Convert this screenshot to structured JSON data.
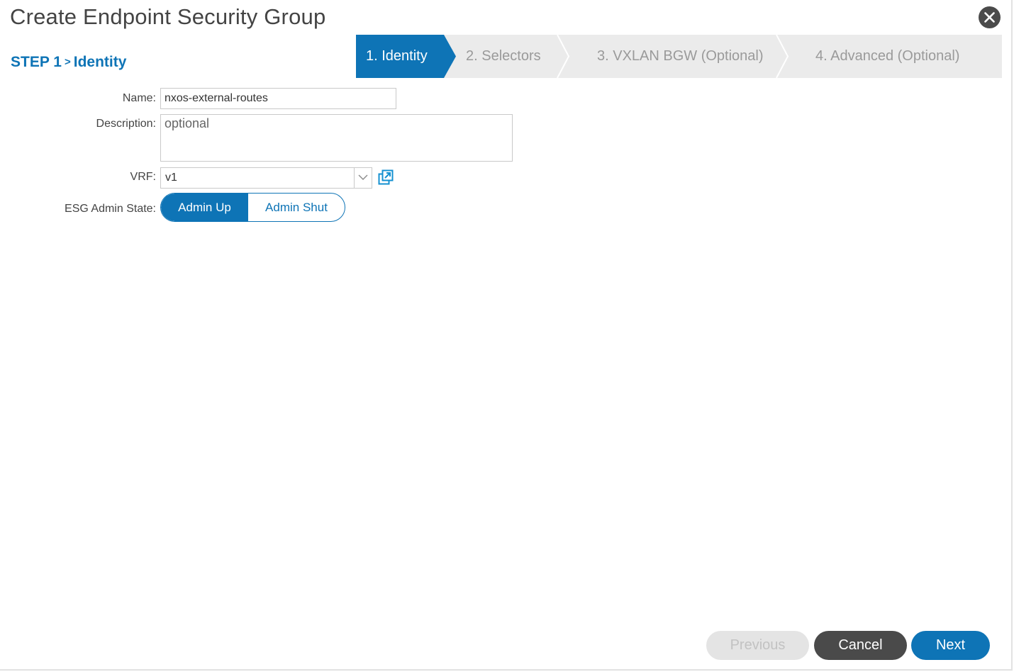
{
  "dialog": {
    "title": "Create Endpoint Security Group",
    "close_icon": "close-icon"
  },
  "step": {
    "prefix": "STEP 1",
    "separator": ">",
    "name": "Identity"
  },
  "wizard": {
    "steps": [
      {
        "label": "1. Identity",
        "active": true
      },
      {
        "label": "2. Selectors",
        "active": false
      },
      {
        "label": "3. VXLAN BGW (Optional)",
        "active": false
      },
      {
        "label": "4. Advanced (Optional)",
        "active": false
      }
    ],
    "active_color": "#0e74b6"
  },
  "form": {
    "name_label": "Name:",
    "name_value": "nxos-external-routes",
    "description_label": "Description:",
    "description_placeholder": "optional",
    "vrf_label": "VRF:",
    "vrf_value": "v1",
    "vrf_popout_icon": "popout-icon",
    "admin_state_label": "ESG Admin State:",
    "admin_up_label": "Admin Up",
    "admin_shut_label": "Admin Shut",
    "admin_state_selected": "Admin Up"
  },
  "footer": {
    "previous_label": "Previous",
    "cancel_label": "Cancel",
    "next_label": "Next"
  }
}
